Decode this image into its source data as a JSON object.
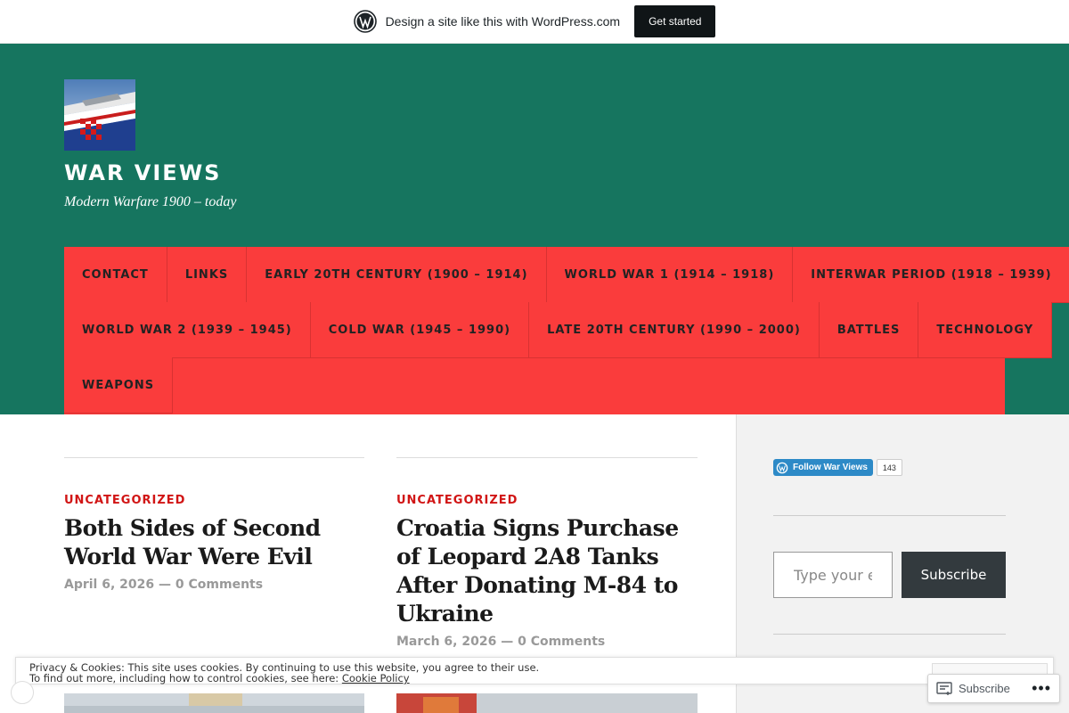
{
  "wpbar": {
    "message": "Design a site like this with WordPress.com",
    "cta": "Get started"
  },
  "site": {
    "title": "WAR VIEWS",
    "tagline": "Modern Warfare 1900 – today"
  },
  "nav": {
    "rows": [
      [
        "CONTACT",
        "LINKS",
        "EARLY 20TH CENTURY (1900 – 1914)",
        "WORLD WAR 1 (1914 – 1918)",
        "INTERWAR PERIOD (1918 – 1939)"
      ],
      [
        "WORLD WAR 2 (1939 – 1945)",
        "COLD WAR (1945 – 1990)",
        "LATE 20TH CENTURY (1990 – 2000)",
        "BATTLES",
        "TECHNOLOGY"
      ],
      [
        "WEAPONS"
      ]
    ]
  },
  "posts": [
    {
      "category": "UNCATEGORIZED",
      "title": "Both Sides of Second World War Were Evil",
      "date": "April 6, 2026",
      "comments": "0 Comments"
    },
    {
      "category": "UNCATEGORIZED",
      "title": "Croatia Signs Purchase of Leopard 2A8 Tanks After Donating M-84 to Ukraine",
      "date": "March 6, 2026",
      "comments": "0 Comments"
    }
  ],
  "meta_separator": "—",
  "sidebar": {
    "follow_label": "Follow War Views",
    "follow_count": "143",
    "email_placeholder": "Type your email…",
    "subscribe_label": "Subscribe"
  },
  "cookie": {
    "line1": "Privacy & Cookies: This site uses cookies. By continuing to use this website, you agree to their use.",
    "line2_prefix": "To find out more, including how to control cookies, see here: ",
    "policy_link": "Cookie Policy"
  },
  "floating": {
    "subscribe_label": "Subscribe",
    "more": "•••"
  },
  "colors": {
    "header_bg": "#16755f",
    "nav_bg": "#fa3c3c",
    "category": "#d11515",
    "follow_button": "#2d8ac7",
    "subscribe_button": "#333a3e"
  }
}
